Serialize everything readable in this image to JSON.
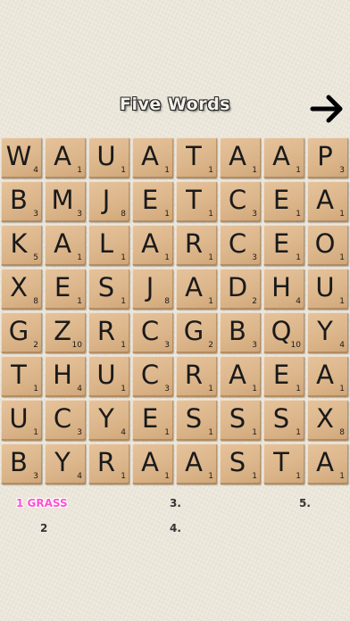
{
  "title": "Five Words",
  "icons": {
    "next": "arrow-right-icon"
  },
  "board": {
    "rows": [
      [
        {
          "l": "W",
          "p": "4"
        },
        {
          "l": "A",
          "p": "1"
        },
        {
          "l": "U",
          "p": "1"
        },
        {
          "l": "A",
          "p": "1"
        },
        {
          "l": "T",
          "p": "1"
        },
        {
          "l": "A",
          "p": "1"
        },
        {
          "l": "A",
          "p": "1"
        },
        {
          "l": "P",
          "p": "3"
        }
      ],
      [
        {
          "l": "B",
          "p": "3"
        },
        {
          "l": "M",
          "p": "3"
        },
        {
          "l": "J",
          "p": "8"
        },
        {
          "l": "E",
          "p": "1"
        },
        {
          "l": "T",
          "p": "1"
        },
        {
          "l": "C",
          "p": "3"
        },
        {
          "l": "E",
          "p": "1"
        },
        {
          "l": "A",
          "p": "1"
        }
      ],
      [
        {
          "l": "K",
          "p": "5"
        },
        {
          "l": "A",
          "p": "1"
        },
        {
          "l": "L",
          "p": "1"
        },
        {
          "l": "A",
          "p": "1"
        },
        {
          "l": "R",
          "p": "1"
        },
        {
          "l": "C",
          "p": "3"
        },
        {
          "l": "E",
          "p": "1"
        },
        {
          "l": "O",
          "p": "1"
        }
      ],
      [
        {
          "l": "X",
          "p": "8"
        },
        {
          "l": "E",
          "p": "1"
        },
        {
          "l": "S",
          "p": "1"
        },
        {
          "l": "J",
          "p": "8"
        },
        {
          "l": "A",
          "p": "1"
        },
        {
          "l": "D",
          "p": "2"
        },
        {
          "l": "H",
          "p": "4"
        },
        {
          "l": "U",
          "p": "1"
        }
      ],
      [
        {
          "l": "G",
          "p": "2"
        },
        {
          "l": "Z",
          "p": "10"
        },
        {
          "l": "R",
          "p": "1"
        },
        {
          "l": "C",
          "p": "3"
        },
        {
          "l": "G",
          "p": "2"
        },
        {
          "l": "B",
          "p": "3"
        },
        {
          "l": "Q",
          "p": "10"
        },
        {
          "l": "Y",
          "p": "4"
        }
      ],
      [
        {
          "l": "T",
          "p": "1"
        },
        {
          "l": "H",
          "p": "4"
        },
        {
          "l": "U",
          "p": "1"
        },
        {
          "l": "C",
          "p": "3"
        },
        {
          "l": "R",
          "p": "1"
        },
        {
          "l": "A",
          "p": "1"
        },
        {
          "l": "E",
          "p": "1"
        },
        {
          "l": "A",
          "p": "1"
        }
      ],
      [
        {
          "l": "U",
          "p": "1"
        },
        {
          "l": "C",
          "p": "3"
        },
        {
          "l": "Y",
          "p": "4"
        },
        {
          "l": "E",
          "p": "1"
        },
        {
          "l": "S",
          "p": "1"
        },
        {
          "l": "S",
          "p": "1"
        },
        {
          "l": "S",
          "p": "1"
        },
        {
          "l": "X",
          "p": "8"
        }
      ],
      [
        {
          "l": "B",
          "p": "3"
        },
        {
          "l": "Y",
          "p": "4"
        },
        {
          "l": "R",
          "p": "1"
        },
        {
          "l": "A",
          "p": "1"
        },
        {
          "l": "A",
          "p": "1"
        },
        {
          "l": "S",
          "p": "1"
        },
        {
          "l": "T",
          "p": "1"
        },
        {
          "l": "A",
          "p": "1"
        }
      ]
    ]
  },
  "word_slots": [
    {
      "text": "1 GRASS",
      "found": true
    },
    {
      "text": "2",
      "found": false
    },
    {
      "text": "3.",
      "found": false
    },
    {
      "text": "4.",
      "found": false
    },
    {
      "text": "5.",
      "found": false
    }
  ],
  "colors": {
    "found_word": "#ff4fd1",
    "tile": "#dcb68b"
  }
}
